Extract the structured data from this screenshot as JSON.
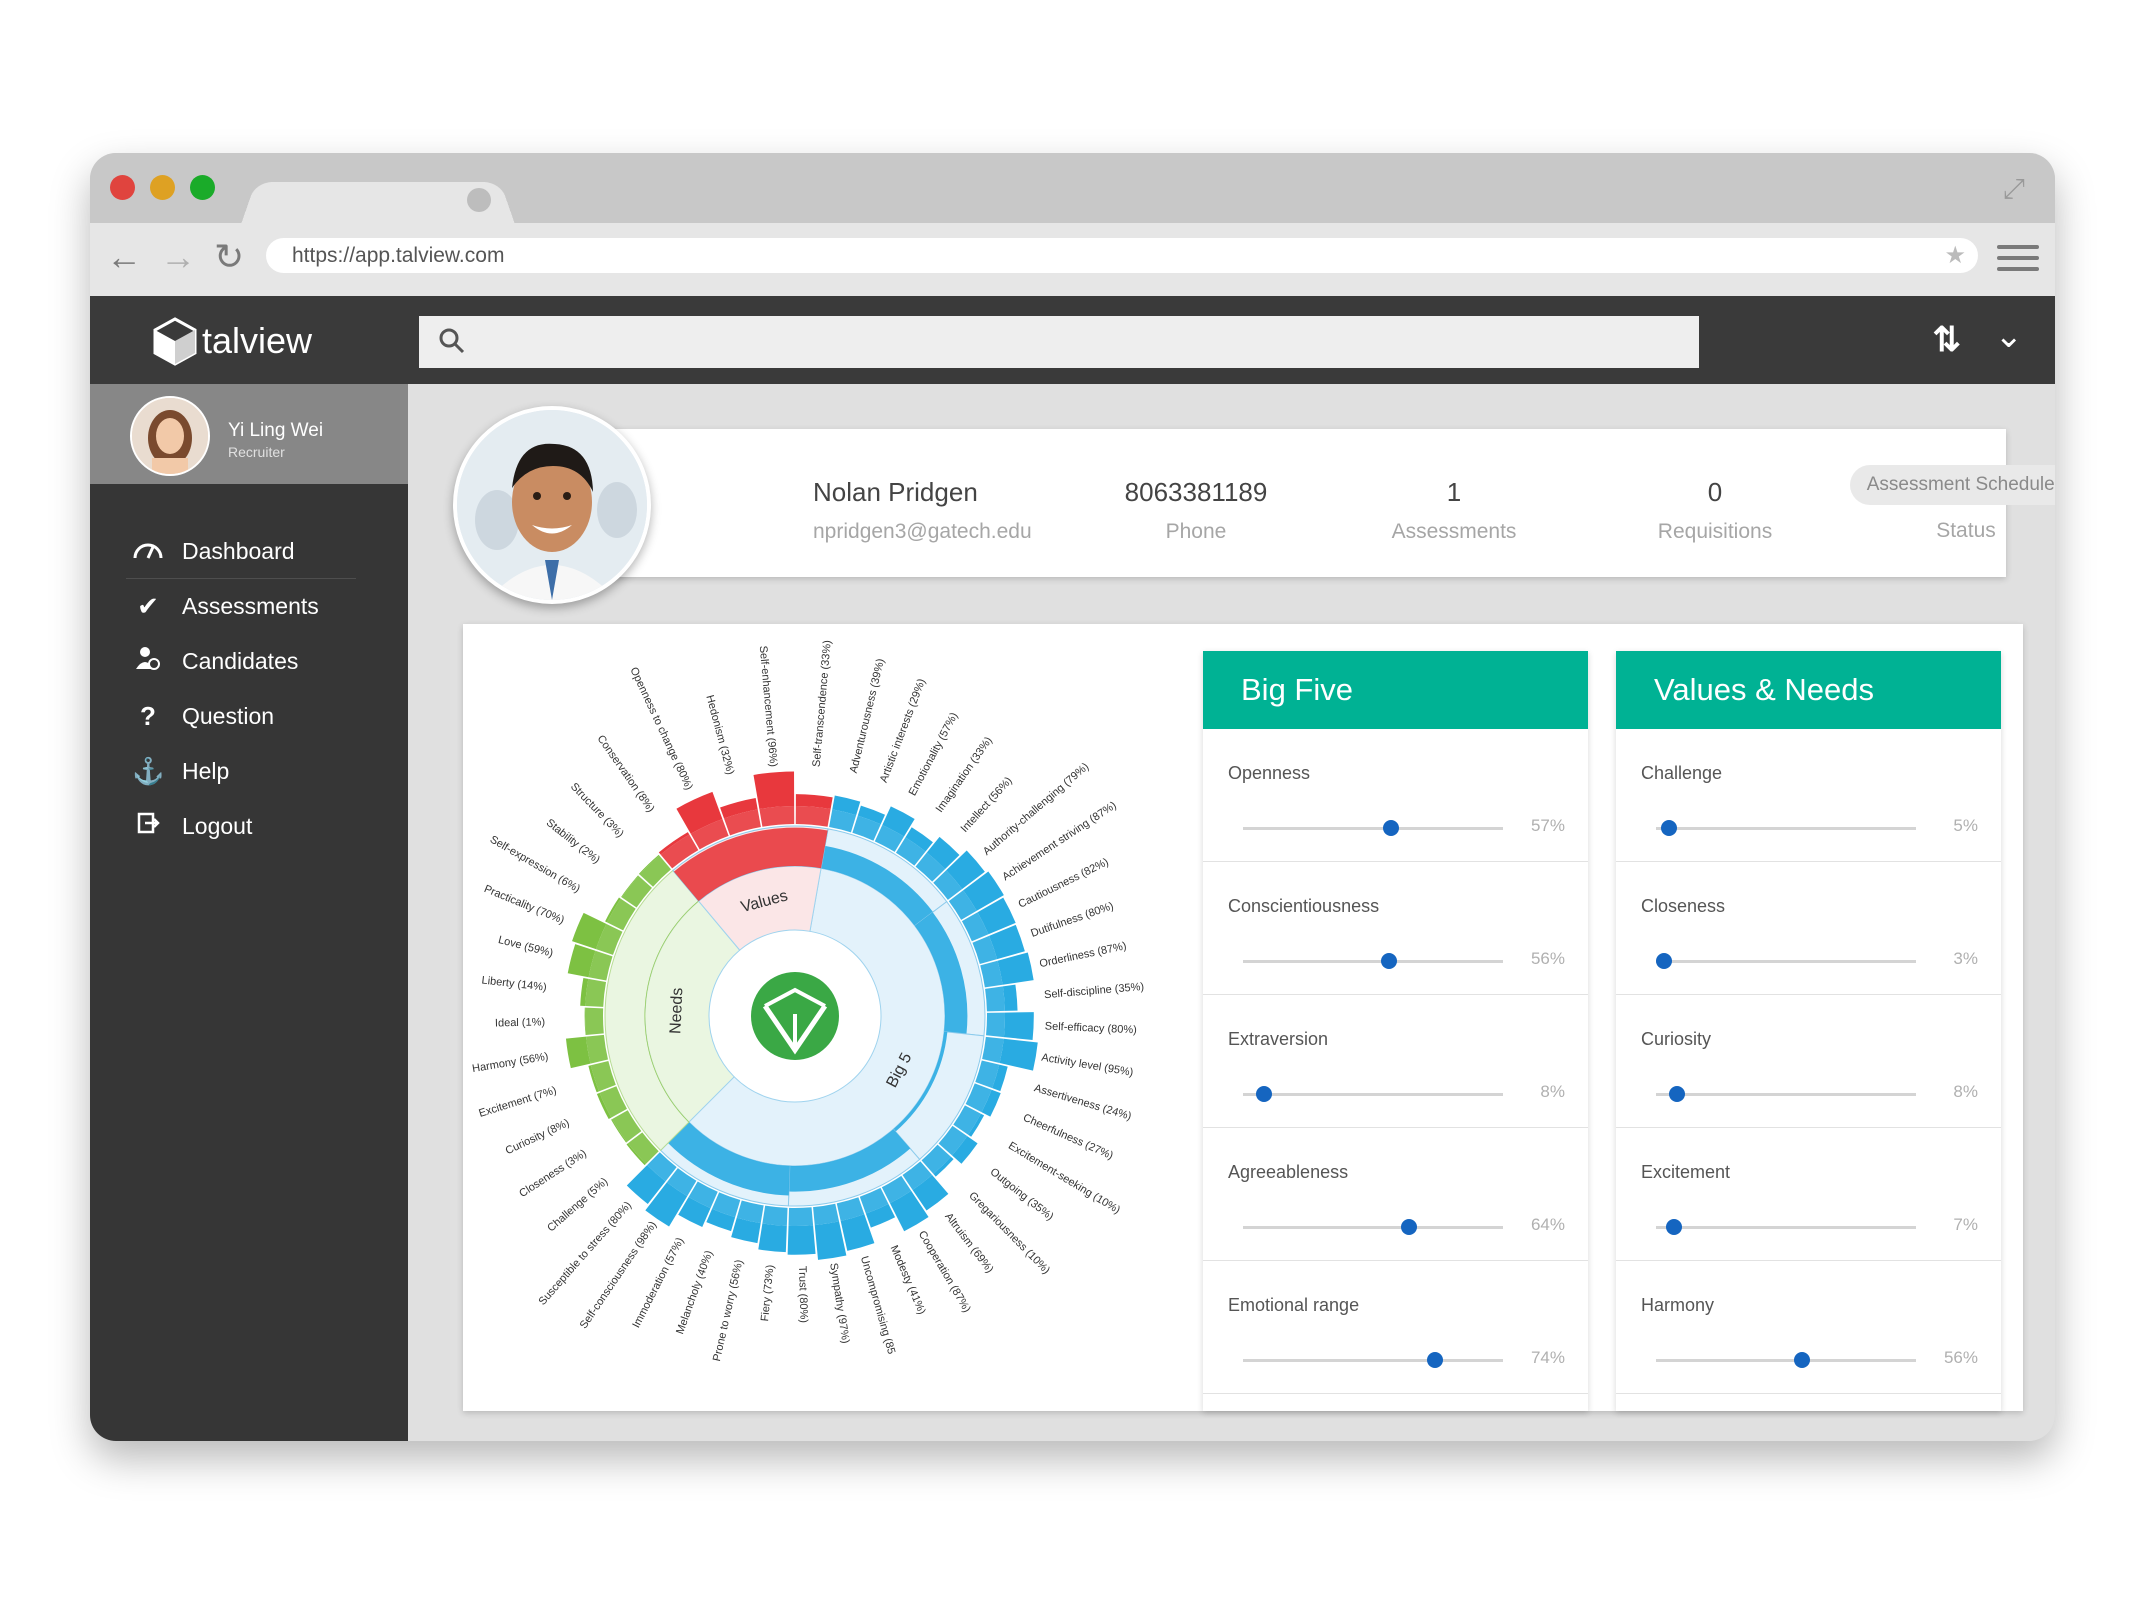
{
  "browser": {
    "url": "https://app.talview.com",
    "traffic_lights": [
      "#e0443e",
      "#dea123",
      "#1aab29"
    ]
  },
  "app": {
    "brand": "talview",
    "search_placeholder": ""
  },
  "user": {
    "name": "Yi Ling Wei",
    "role": "Recruiter"
  },
  "nav": {
    "items": [
      {
        "label": "Dashboard",
        "icon": "dashboard-icon"
      },
      {
        "label": "Assessments",
        "icon": "checkmark-icon"
      },
      {
        "label": "Candidates",
        "icon": "candidate-icon"
      },
      {
        "label": "Question",
        "icon": "question-icon"
      },
      {
        "label": "Help",
        "icon": "anchor-icon"
      },
      {
        "label": "Logout",
        "icon": "logout-icon"
      }
    ]
  },
  "candidate": {
    "name": "Nolan Pridgen",
    "email": "npridgen3@gatech.edu",
    "phone": "8063381189",
    "phone_label": "Phone",
    "assessments": "1",
    "assessments_label": "Assessments",
    "requisitions": "0",
    "requisitions_label": "Requisitions",
    "status": "Assessment Scheduled",
    "status_label": "Status"
  },
  "big_five": {
    "title": "Big Five",
    "traits": [
      {
        "name": "Openness",
        "value": 57,
        "label": "57%"
      },
      {
        "name": "Conscientiousness",
        "value": 56,
        "label": "56%"
      },
      {
        "name": "Extraversion",
        "value": 8,
        "label": "8%"
      },
      {
        "name": "Agreeableness",
        "value": 64,
        "label": "64%"
      },
      {
        "name": "Emotional range",
        "value": 74,
        "label": "74%"
      }
    ]
  },
  "values_needs": {
    "title": "Values & Needs",
    "traits": [
      {
        "name": "Challenge",
        "value": 5,
        "label": "5%"
      },
      {
        "name": "Closeness",
        "value": 3,
        "label": "3%"
      },
      {
        "name": "Curiosity",
        "value": 8,
        "label": "8%"
      },
      {
        "name": "Excitement",
        "value": 7,
        "label": "7%"
      },
      {
        "name": "Harmony",
        "value": 56,
        "label": "56%"
      }
    ]
  },
  "sunburst": {
    "center_labels": {
      "values": "Values",
      "needs": "Needs",
      "big5": "Big 5"
    },
    "colors": {
      "big5": "#29abe2",
      "needs": "#7dc142",
      "values": "#e8383d"
    },
    "groups": [
      {
        "name": "Openness",
        "label": "Openness (57%)",
        "value": 57
      },
      {
        "name": "Conscientiousness",
        "label": "Conscientiousness (56%)",
        "value": 56
      },
      {
        "name": "Extraversion",
        "label": "Extraversion (8%)",
        "value": 8
      },
      {
        "name": "Agreeableness",
        "label": "Agreeableness (64%)",
        "value": 64
      },
      {
        "name": "Emotional range",
        "label": "Emotional range (74%)",
        "value": 74
      },
      {
        "name": "Needs",
        "label": "Ideal (1%)",
        "value": 1
      },
      {
        "name": "Values",
        "label": "Self-enhancement (96%)",
        "value": 96
      }
    ],
    "facets": [
      {
        "label": "Adventurousness (39%)",
        "value": 39,
        "cat": "big5"
      },
      {
        "label": "Artistic interests (29%)",
        "value": 29,
        "cat": "big5"
      },
      {
        "label": "Emotionality (57%)",
        "value": 57,
        "cat": "big5"
      },
      {
        "label": "Imagination (33%)",
        "value": 33,
        "cat": "big5"
      },
      {
        "label": "Intellect (56%)",
        "value": 56,
        "cat": "big5"
      },
      {
        "label": "Authority-challenging (79%)",
        "value": 79,
        "cat": "big5"
      },
      {
        "label": "Achievement striving (87%)",
        "value": 87,
        "cat": "big5"
      },
      {
        "label": "Cautiousness (82%)",
        "value": 82,
        "cat": "big5"
      },
      {
        "label": "Dutifulness (80%)",
        "value": 80,
        "cat": "big5"
      },
      {
        "label": "Orderliness (87%)",
        "value": 87,
        "cat": "big5"
      },
      {
        "label": "Self-discipline (35%)",
        "value": 35,
        "cat": "big5"
      },
      {
        "label": "Self-efficacy (80%)",
        "value": 80,
        "cat": "big5"
      },
      {
        "label": "Activity level (95%)",
        "value": 95,
        "cat": "big5"
      },
      {
        "label": "Assertiveness (24%)",
        "value": 24,
        "cat": "big5"
      },
      {
        "label": "Cheerfulness (27%)",
        "value": 27,
        "cat": "big5"
      },
      {
        "label": "Excitement-seeking (10%)",
        "value": 10,
        "cat": "big5"
      },
      {
        "label": "Outgoing (35%)",
        "value": 35,
        "cat": "big5"
      },
      {
        "label": "Gregariousness (10%)",
        "value": 10,
        "cat": "big5"
      },
      {
        "label": "Altruism (69%)",
        "value": 69,
        "cat": "big5"
      },
      {
        "label": "Cooperation (87%)",
        "value": 87,
        "cat": "big5"
      },
      {
        "label": "Modesty (41%)",
        "value": 41,
        "cat": "big5"
      },
      {
        "label": "Uncompromising (85",
        "value": 85,
        "cat": "big5"
      },
      {
        "label": "Sympathy (97%)",
        "value": 97,
        "cat": "big5"
      },
      {
        "label": "Trust (80%)",
        "value": 80,
        "cat": "big5"
      },
      {
        "label": "Fiery (73%)",
        "value": 73,
        "cat": "big5"
      },
      {
        "label": "Prone to worry (56%)",
        "value": 56,
        "cat": "big5"
      },
      {
        "label": "Melancholy (40%)",
        "value": 40,
        "cat": "big5"
      },
      {
        "label": "Immoderation (57%)",
        "value": 57,
        "cat": "big5"
      },
      {
        "label": "Self-consciousness (98%)",
        "value": 98,
        "cat": "big5"
      },
      {
        "label": "Susceptible to stress (80%)",
        "value": 80,
        "cat": "big5"
      },
      {
        "label": "Challenge (5%)",
        "value": 5,
        "cat": "needs"
      },
      {
        "label": "Closeness (3%)",
        "value": 3,
        "cat": "needs"
      },
      {
        "label": "Curiosity (8%)",
        "value": 8,
        "cat": "needs"
      },
      {
        "label": "Excitement (7%)",
        "value": 7,
        "cat": "needs"
      },
      {
        "label": "Harmony (56%)",
        "value": 56,
        "cat": "needs"
      },
      {
        "label": "Ideal (1%)",
        "value": 1,
        "cat": "needs"
      },
      {
        "label": "Liberty (14%)",
        "value": 14,
        "cat": "needs"
      },
      {
        "label": "Love (59%)",
        "value": 59,
        "cat": "needs"
      },
      {
        "label": "Practicality (70%)",
        "value": 70,
        "cat": "needs"
      },
      {
        "label": "Self-expression (6%)",
        "value": 6,
        "cat": "needs"
      },
      {
        "label": "Stability (2%)",
        "value": 2,
        "cat": "needs"
      },
      {
        "label": "Structure (3%)",
        "value": 3,
        "cat": "needs"
      },
      {
        "label": "Conservation (8%)",
        "value": 8,
        "cat": "values"
      },
      {
        "label": "Openness to change (80%)",
        "value": 80,
        "cat": "values"
      },
      {
        "label": "Hedonism (32%)",
        "value": 32,
        "cat": "values"
      },
      {
        "label": "Self-enhancement (96%)",
        "value": 96,
        "cat": "values"
      },
      {
        "label": "Self-transcendence (33%)",
        "value": 33,
        "cat": "values"
      }
    ]
  }
}
